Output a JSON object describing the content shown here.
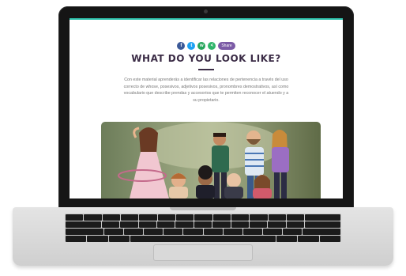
{
  "screen": {
    "accent_color": "#2bbfa9",
    "title_color": "#3b2c46",
    "share": {
      "buttons": [
        {
          "icon": "facebook-icon",
          "glyph": "f",
          "color": "#3b5998"
        },
        {
          "icon": "twitter-icon",
          "glyph": "t",
          "color": "#1da1f2"
        },
        {
          "icon": "whatsapp-icon",
          "glyph": "w",
          "color": "#25a55a"
        },
        {
          "icon": "share-icon",
          "glyph": "<",
          "color": "#2fb56a"
        }
      ],
      "pill_label": "Share",
      "pill_color": "#7b5ba6"
    },
    "page_title": "WHAT DO YOU LOOK LIKE?",
    "intro": "Con este material aprenderás a identificar las relaciones de pertenencia a través del uso correcto de whose, posesivos, adjetivos posesivos, pronombres demostrativos, así como vocabulario que describe prendas y accesorios que te permiten reconocer el atuendo y a su propietario."
  }
}
